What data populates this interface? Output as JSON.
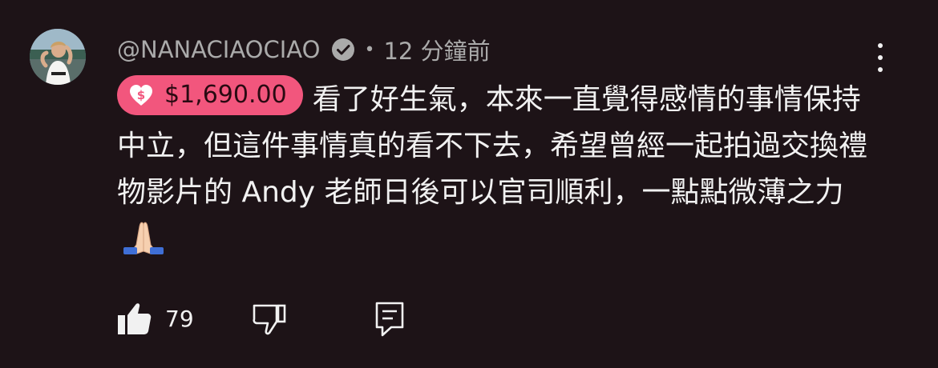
{
  "comment": {
    "username": "@NANACIAOCIAO",
    "separator": "•",
    "timestamp": "12 分鐘前",
    "super_thanks": {
      "amount": "$1,690.00",
      "color": "#f2567d"
    },
    "text": "看了好生氣，本來一直覺得感情的事情保持中立，但這件事情真的看不下去，希望曾經一起拍過交換禮物影片的 Andy 老師日後可以官司順利，一點點微薄之力"
  },
  "actions": {
    "like_count": "79"
  },
  "icons": [
    "verified-icon",
    "more-vert-icon",
    "heart-dollar-icon",
    "folded-hands-emoji",
    "thumbs-up-icon",
    "thumbs-down-icon",
    "reply-comment-icon"
  ],
  "colors": {
    "background": "#1d1317",
    "text": "#f1f1f1",
    "muted": "#aaaaaa"
  }
}
